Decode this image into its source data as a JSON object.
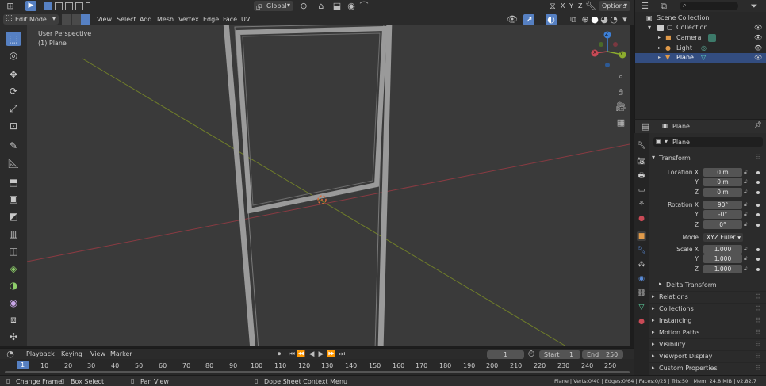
{
  "header": {
    "mode": "Edit Mode",
    "menu": [
      "View",
      "Select",
      "Add",
      "Mesh",
      "Vertex",
      "Edge",
      "Face",
      "UV"
    ],
    "orientation": "Global",
    "options": "Options",
    "axes": [
      "X",
      "Y",
      "Z"
    ]
  },
  "viewport": {
    "perspective": "User Perspective",
    "object": "(1) Plane"
  },
  "gizmo": {
    "x": "X",
    "y": "Y",
    "z": "Z"
  },
  "outliner": {
    "items": [
      {
        "label": "Scene Collection"
      },
      {
        "label": "Collection"
      },
      {
        "label": "Camera"
      },
      {
        "label": "Light"
      },
      {
        "label": "Plane"
      }
    ]
  },
  "properties": {
    "context_name": "Plane",
    "object_name": "Plane",
    "transform_title": "Transform",
    "location": {
      "label": "Location X",
      "x": "0 m",
      "y": "0 m",
      "z": "0 m"
    },
    "rotation": {
      "label": "Rotation X",
      "x": "90°",
      "y": "-0°",
      "z": "0°"
    },
    "mode": {
      "label": "Mode",
      "value": "XYZ Euler"
    },
    "scale": {
      "label": "Scale X",
      "x": "1.000",
      "y": "1.000",
      "z": "1.000"
    },
    "axis_y": "Y",
    "axis_z": "Z",
    "delta": "Delta Transform",
    "panels": [
      "Relations",
      "Collections",
      "Instancing",
      "Motion Paths",
      "Visibility",
      "Viewport Display",
      "Custom Properties"
    ]
  },
  "timeline": {
    "menus": [
      "Playback",
      "Keying",
      "View",
      "Marker"
    ],
    "current_frame": "1",
    "start_label": "Start",
    "start": "1",
    "end_label": "End",
    "end": "250",
    "ticks": [
      "1",
      "10",
      "20",
      "30",
      "40",
      "50",
      "60",
      "70",
      "80",
      "90",
      "100",
      "110",
      "120",
      "130",
      "140",
      "150",
      "160",
      "170",
      "180",
      "190",
      "200",
      "210",
      "220",
      "230",
      "240",
      "250"
    ]
  },
  "status": {
    "left": "Change Frame",
    "mid": "Box Select",
    "pan": "Pan View",
    "context": "Dope Sheet Context Menu",
    "stats": "Plane | Verts:0/40 | Edges:0/64 | Faces:0/25 | Tris:50 | Mem: 24.8 MiB | v2.82.7"
  },
  "colors": {
    "accent": "#5680c2",
    "selected_row": "#334d80",
    "x_axis": "#c94a56",
    "y_axis": "#8cab2e",
    "z_axis": "#3d7fd6"
  }
}
